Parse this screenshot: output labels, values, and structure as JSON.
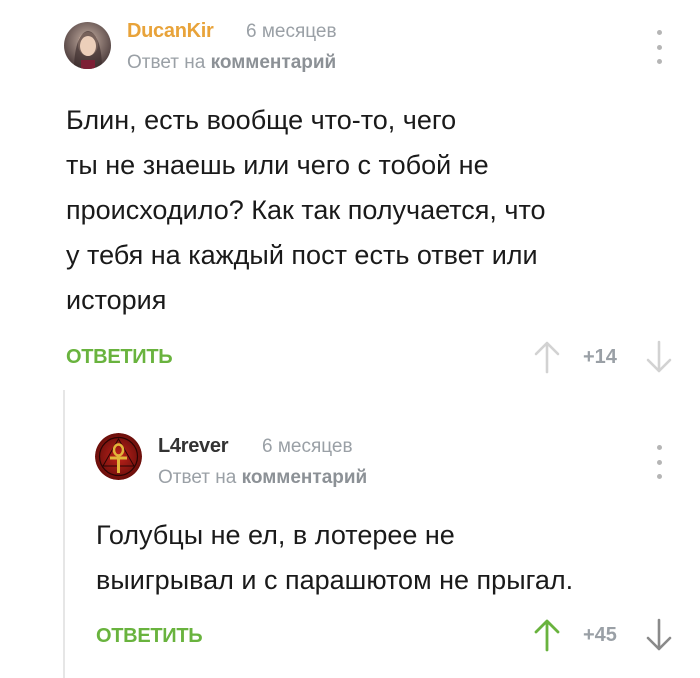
{
  "comments": [
    {
      "username": "DucanKir",
      "time": "6 месяцев",
      "reply_prefix": "Ответ на",
      "reply_target": "комментарий",
      "text": "Блин, есть вообще что-то, чего\nты не знаешь или чего с тобой не\nпроисходило? Как так получается, что\nу тебя на каждый пост есть ответ или\nистория",
      "reply_label": "ОТВЕТИТЬ",
      "score": "+14",
      "upvoted": false
    },
    {
      "username": "L4rever",
      "time": "6 месяцев",
      "reply_prefix": "Ответ на",
      "reply_target": "комментарий",
      "text": "Голубцы не ел, в лотерее не\nвыигрывал и с парашютом не прыгал.",
      "reply_label": "ОТВЕТИТЬ",
      "score": "+45",
      "upvoted": true
    }
  ],
  "colors": {
    "accent_green": "#69b33e",
    "username_orange": "#e8a33a",
    "muted": "#9aa0a6"
  }
}
